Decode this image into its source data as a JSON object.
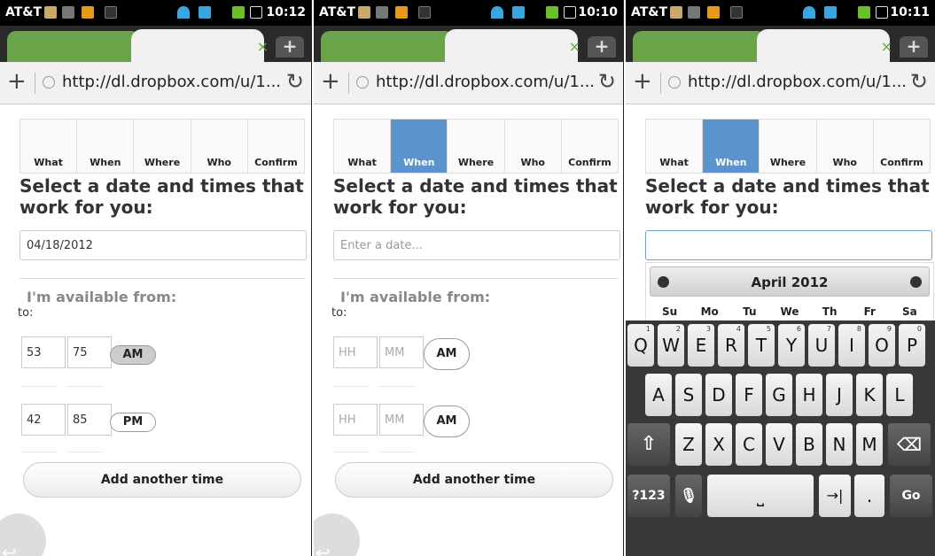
{
  "statusbar": {
    "carrier": "AT&T",
    "times": [
      "10:12",
      "10:10",
      "10:11"
    ],
    "icons": [
      "media-icon",
      "signal-bars-icon",
      "battery-orange-icon",
      "usb-icon",
      "wifi-icon",
      "4g-icon",
      "battery-green-icon",
      "checkbox-icon"
    ]
  },
  "browser": {
    "url": "http://dl.dropbox.com/u/1...",
    "tab_close": "×",
    "tab_new": "+",
    "nav_plus": "+"
  },
  "steps": [
    "What",
    "When",
    "Where",
    "Who",
    "Confirm"
  ],
  "heading": "Select a date and times that work for you:",
  "screens": [
    {
      "date_value": "04/18/2012",
      "time_rows": [
        {
          "hh": "53",
          "mm": "75",
          "ampm": "AM",
          "ampm_selected": true
        },
        {
          "hh": "42",
          "mm": "85",
          "ampm": "PM",
          "ampm_selected": false
        }
      ]
    },
    {
      "date_placeholder": "Enter a date...",
      "time_rows": [
        {
          "hh_placeholder": "HH",
          "mm_placeholder": "MM",
          "ampm": "AM"
        },
        {
          "hh_placeholder": "HH",
          "mm_placeholder": "MM",
          "ampm": "AM"
        }
      ]
    },
    {
      "date_value": "",
      "calendar": {
        "month": "April 2012",
        "weekdays": [
          "Su",
          "Mo",
          "Tu",
          "We",
          "Th",
          "Fr",
          "Sa"
        ]
      }
    }
  ],
  "available_label": "I'm available from:",
  "to_label": "to:",
  "add_button": "Add another time",
  "keyboard": {
    "row1": [
      {
        "k": "Q",
        "n": "1"
      },
      {
        "k": "W",
        "n": "2"
      },
      {
        "k": "E",
        "n": "3"
      },
      {
        "k": "R",
        "n": "4"
      },
      {
        "k": "T",
        "n": "5"
      },
      {
        "k": "Y",
        "n": "6"
      },
      {
        "k": "U",
        "n": "7"
      },
      {
        "k": "I",
        "n": "8"
      },
      {
        "k": "O",
        "n": "9"
      },
      {
        "k": "P",
        "n": "0"
      }
    ],
    "row2": [
      "A",
      "S",
      "D",
      "F",
      "G",
      "H",
      "J",
      "K",
      "L"
    ],
    "row3": [
      "Z",
      "X",
      "C",
      "V",
      "B",
      "N",
      "M"
    ],
    "symbols": "?123",
    "space": "⎵",
    "tab": "→|",
    "period": ".",
    "go": "Go",
    "shift": "⇧",
    "delete": "⌫",
    "mic": "🎙"
  },
  "colors": {
    "active_step": "#5b93cc",
    "tab_green": "#6aa34a"
  }
}
